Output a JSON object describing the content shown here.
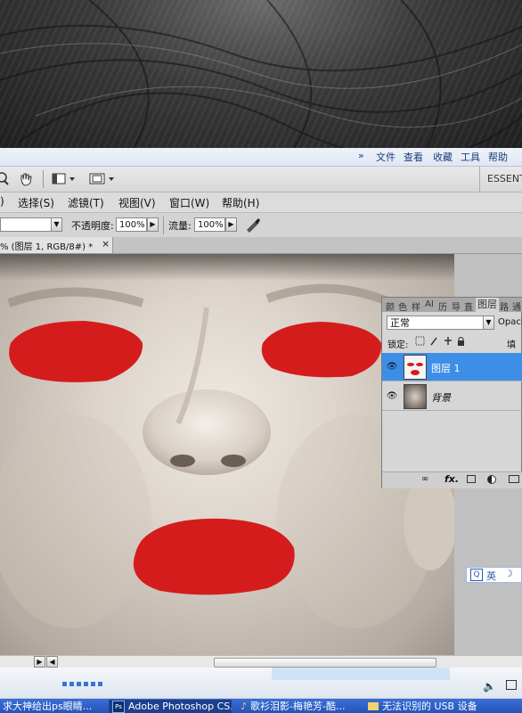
{
  "browser_menu": {
    "chevron": "»",
    "items": [
      "文件",
      "查看",
      "收藏",
      "工具",
      "帮助"
    ]
  },
  "app_bar": {
    "workspace_label": "ESSENT"
  },
  "menu_bar": {
    "items": [
      "选择(S)",
      "滤镜(T)",
      "视图(V)",
      "窗口(W)",
      "帮助(H)"
    ],
    "cut_left_item": ")"
  },
  "options_bar": {
    "opacity_label": "不透明度:",
    "opacity_value": "100%",
    "flow_label": "流量:",
    "flow_value": "100%"
  },
  "document_tab": {
    "title": "% (图层 1, RGB/8#) *",
    "close": "×"
  },
  "layers_panel": {
    "tabs": [
      "颜",
      "色",
      "样",
      "AI",
      "历",
      "导",
      "直",
      "图层",
      "路",
      "通"
    ],
    "blend_mode": "正常",
    "opacity_label": "Opacit",
    "lock_label": "锁定:",
    "fill_label": "填充",
    "layers": [
      {
        "name": "图层 1",
        "selected": true
      },
      {
        "name": "背景",
        "selected": false
      }
    ],
    "footer_icons": [
      "link-icon",
      "fx-icon",
      "mask-icon",
      "adjustment-icon",
      "folder-icon"
    ],
    "fx_label": "fx."
  },
  "ime_bar": {
    "lang": "英"
  },
  "taskbar": {
    "items": [
      "求大神给出ps眼睛...",
      "Adobe Photoshop CS...",
      "歌衫泪影-梅艳芳-酷...",
      "无法识别的 USB 设备"
    ]
  },
  "colors": {
    "red_paint": "#d51c1c",
    "selection_blue": "#3d8ee6",
    "taskbar_blue": "#2454b8"
  }
}
